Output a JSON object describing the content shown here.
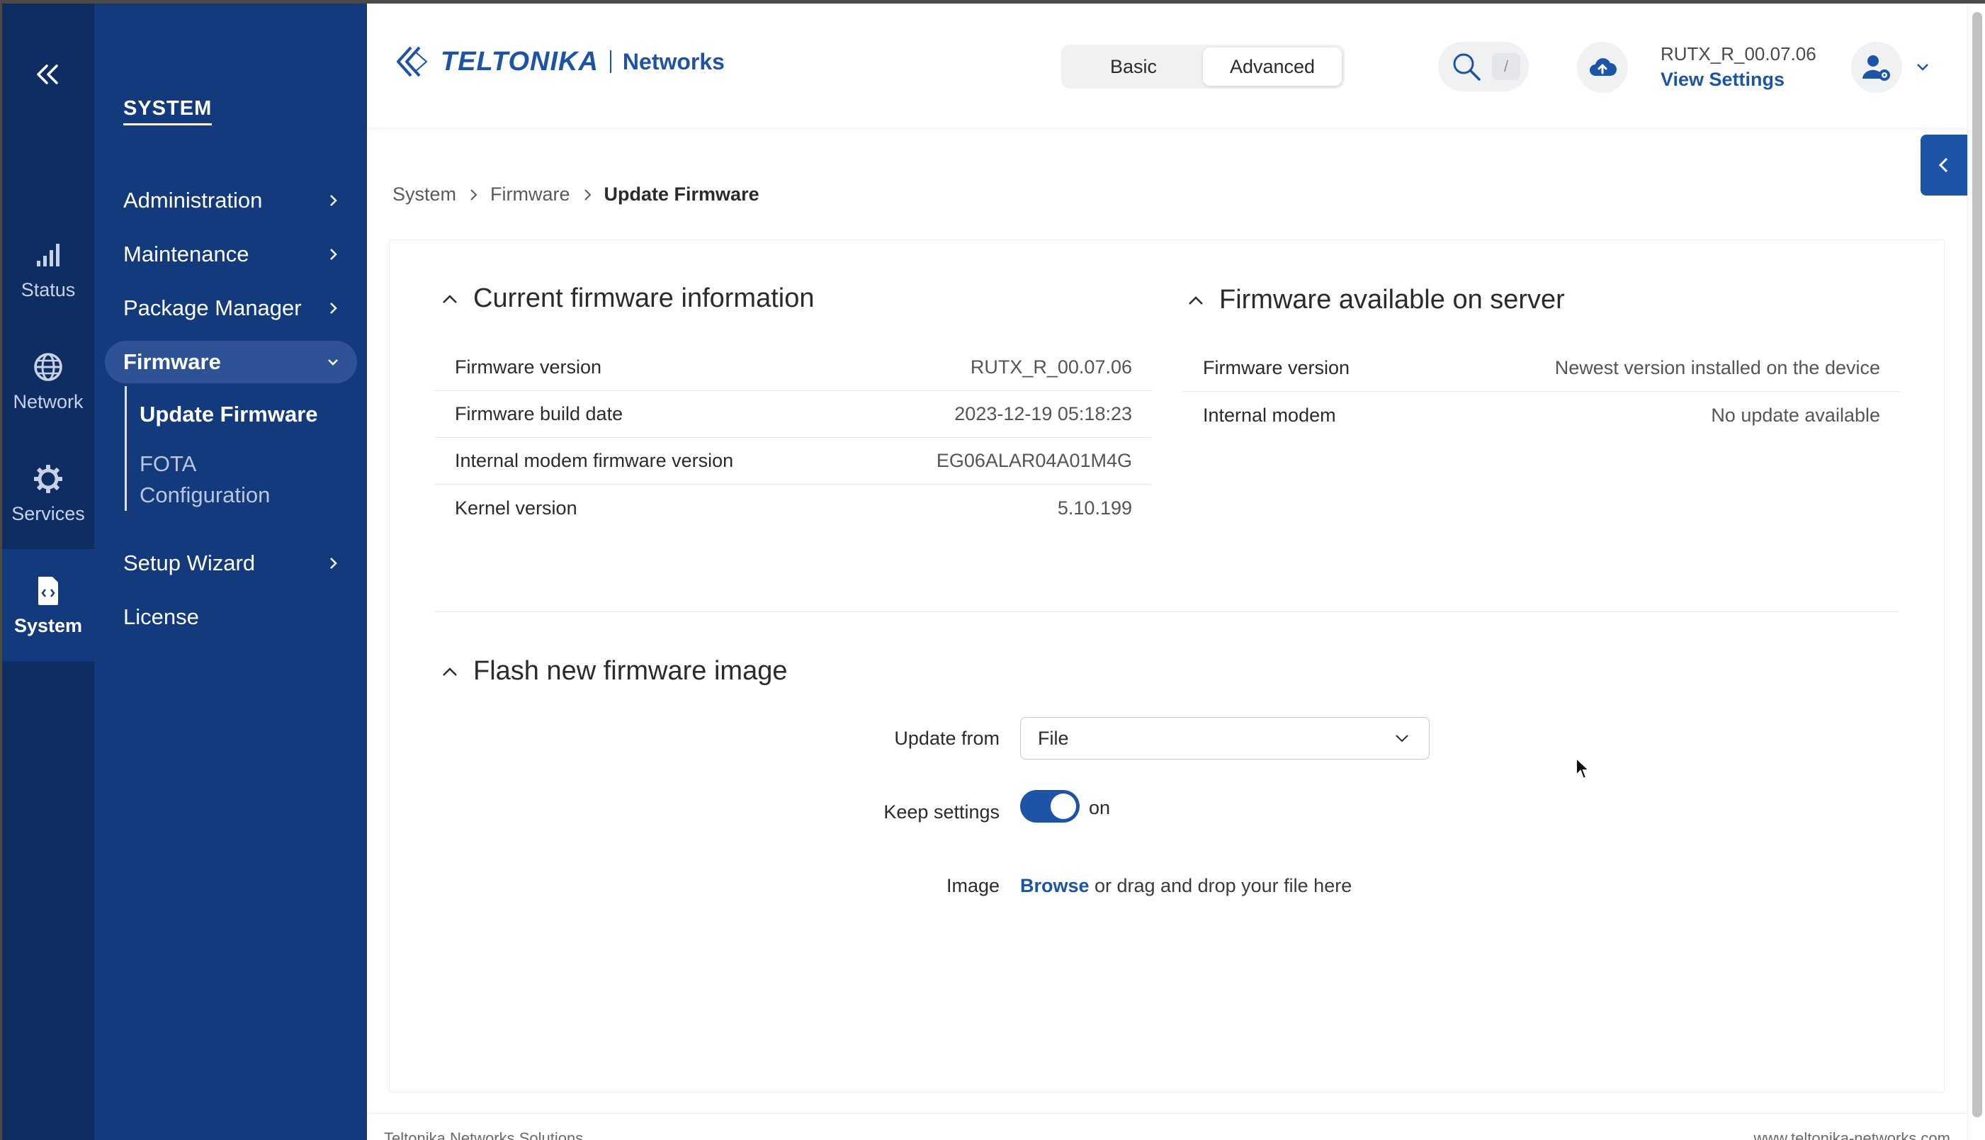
{
  "rail": {
    "items": [
      {
        "label": "Status",
        "icon": "signal-bars-icon"
      },
      {
        "label": "Network",
        "icon": "globe-icon"
      },
      {
        "label": "Services",
        "icon": "gear-icon"
      },
      {
        "label": "System",
        "icon": "document-code-icon"
      }
    ],
    "active": "System"
  },
  "nav": {
    "section_title": "SYSTEM",
    "items": [
      {
        "label": "Administration"
      },
      {
        "label": "Maintenance"
      },
      {
        "label": "Package Manager"
      },
      {
        "label": "Firmware"
      },
      {
        "label": "Setup Wizard"
      },
      {
        "label": "License"
      }
    ],
    "firmware_sub": [
      {
        "label": "Update Firmware"
      },
      {
        "label": "FOTA"
      },
      {
        "label": "Configuration"
      }
    ]
  },
  "header": {
    "logo_text": "TELTONIKA",
    "logo_networks": "Networks",
    "mode_basic": "Basic",
    "mode_advanced": "Advanced",
    "search_shortcut": "/",
    "firmware_version": "RUTX_R_00.07.06",
    "view_settings": "View Settings"
  },
  "breadcrumb": [
    "System",
    "Firmware",
    "Update Firmware"
  ],
  "current_firmware": {
    "title": "Current firmware information",
    "rows": [
      {
        "key": "Firmware version",
        "value": "RUTX_R_00.07.06"
      },
      {
        "key": "Firmware build date",
        "value": "2023-12-19 05:18:23"
      },
      {
        "key": "Internal modem firmware version",
        "value": "EG06ALAR04A01M4G"
      },
      {
        "key": "Kernel version",
        "value": "5.10.199"
      }
    ]
  },
  "server_firmware": {
    "title": "Firmware available on server",
    "rows": [
      {
        "key": "Firmware version",
        "value": "Newest version installed on the device"
      },
      {
        "key": "Internal modem",
        "value": "No update available"
      }
    ]
  },
  "flash": {
    "title": "Flash new firmware image",
    "update_from_label": "Update from",
    "update_from_value": "File",
    "keep_settings_label": "Keep settings",
    "keep_settings_state": "on",
    "image_label": "Image",
    "browse": "Browse",
    "drop_text": "or drag and drop your file here"
  },
  "footer": {
    "left": "Teltonika Networks Solutions",
    "right": "www.teltonika-networks.com"
  },
  "colors": {
    "rail_bg": "#0e2d63",
    "nav_bg": "#133a7c",
    "accent": "#1d54a6"
  }
}
